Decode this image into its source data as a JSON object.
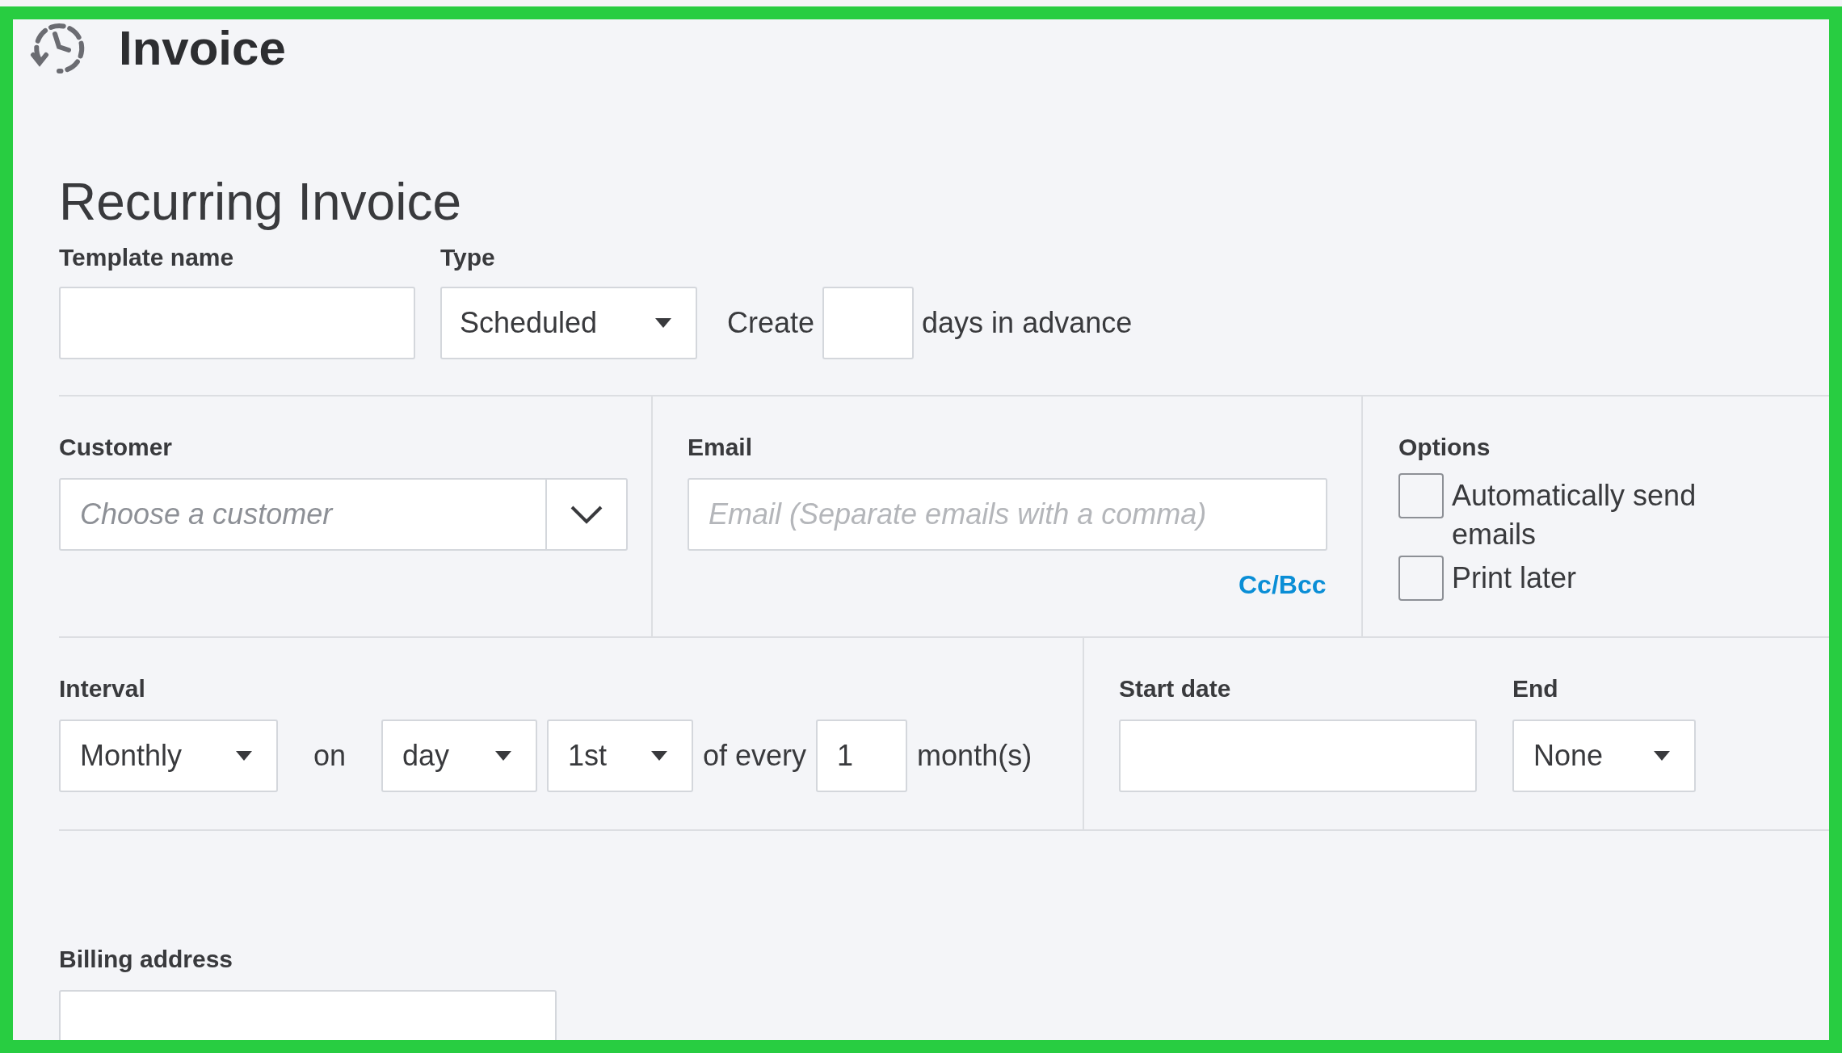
{
  "header": {
    "title": "Invoice"
  },
  "form": {
    "title": "Recurring Invoice",
    "template_name": {
      "label": "Template name"
    },
    "type": {
      "label": "Type",
      "value": "Scheduled"
    },
    "create": {
      "prefix": "Create",
      "suffix": "days in advance"
    },
    "customer": {
      "label": "Customer",
      "placeholder": "Choose a customer"
    },
    "email": {
      "label": "Email",
      "placeholder": "Email (Separate emails with a comma)",
      "link": "Cc/Bcc"
    },
    "options": {
      "label": "Options",
      "items": [
        {
          "label": "Automatically send emails",
          "checked": false
        },
        {
          "label": "Print later",
          "checked": false
        }
      ]
    },
    "interval": {
      "label": "Interval",
      "frequency": "Monthly",
      "on": "on",
      "unit": "day",
      "day": "1st",
      "of_every": "of every",
      "count": "1",
      "suffix": "month(s)"
    },
    "start_date": {
      "label": "Start date"
    },
    "end": {
      "label": "End",
      "value": "None"
    },
    "billing_address": {
      "label": "Billing address"
    }
  }
}
